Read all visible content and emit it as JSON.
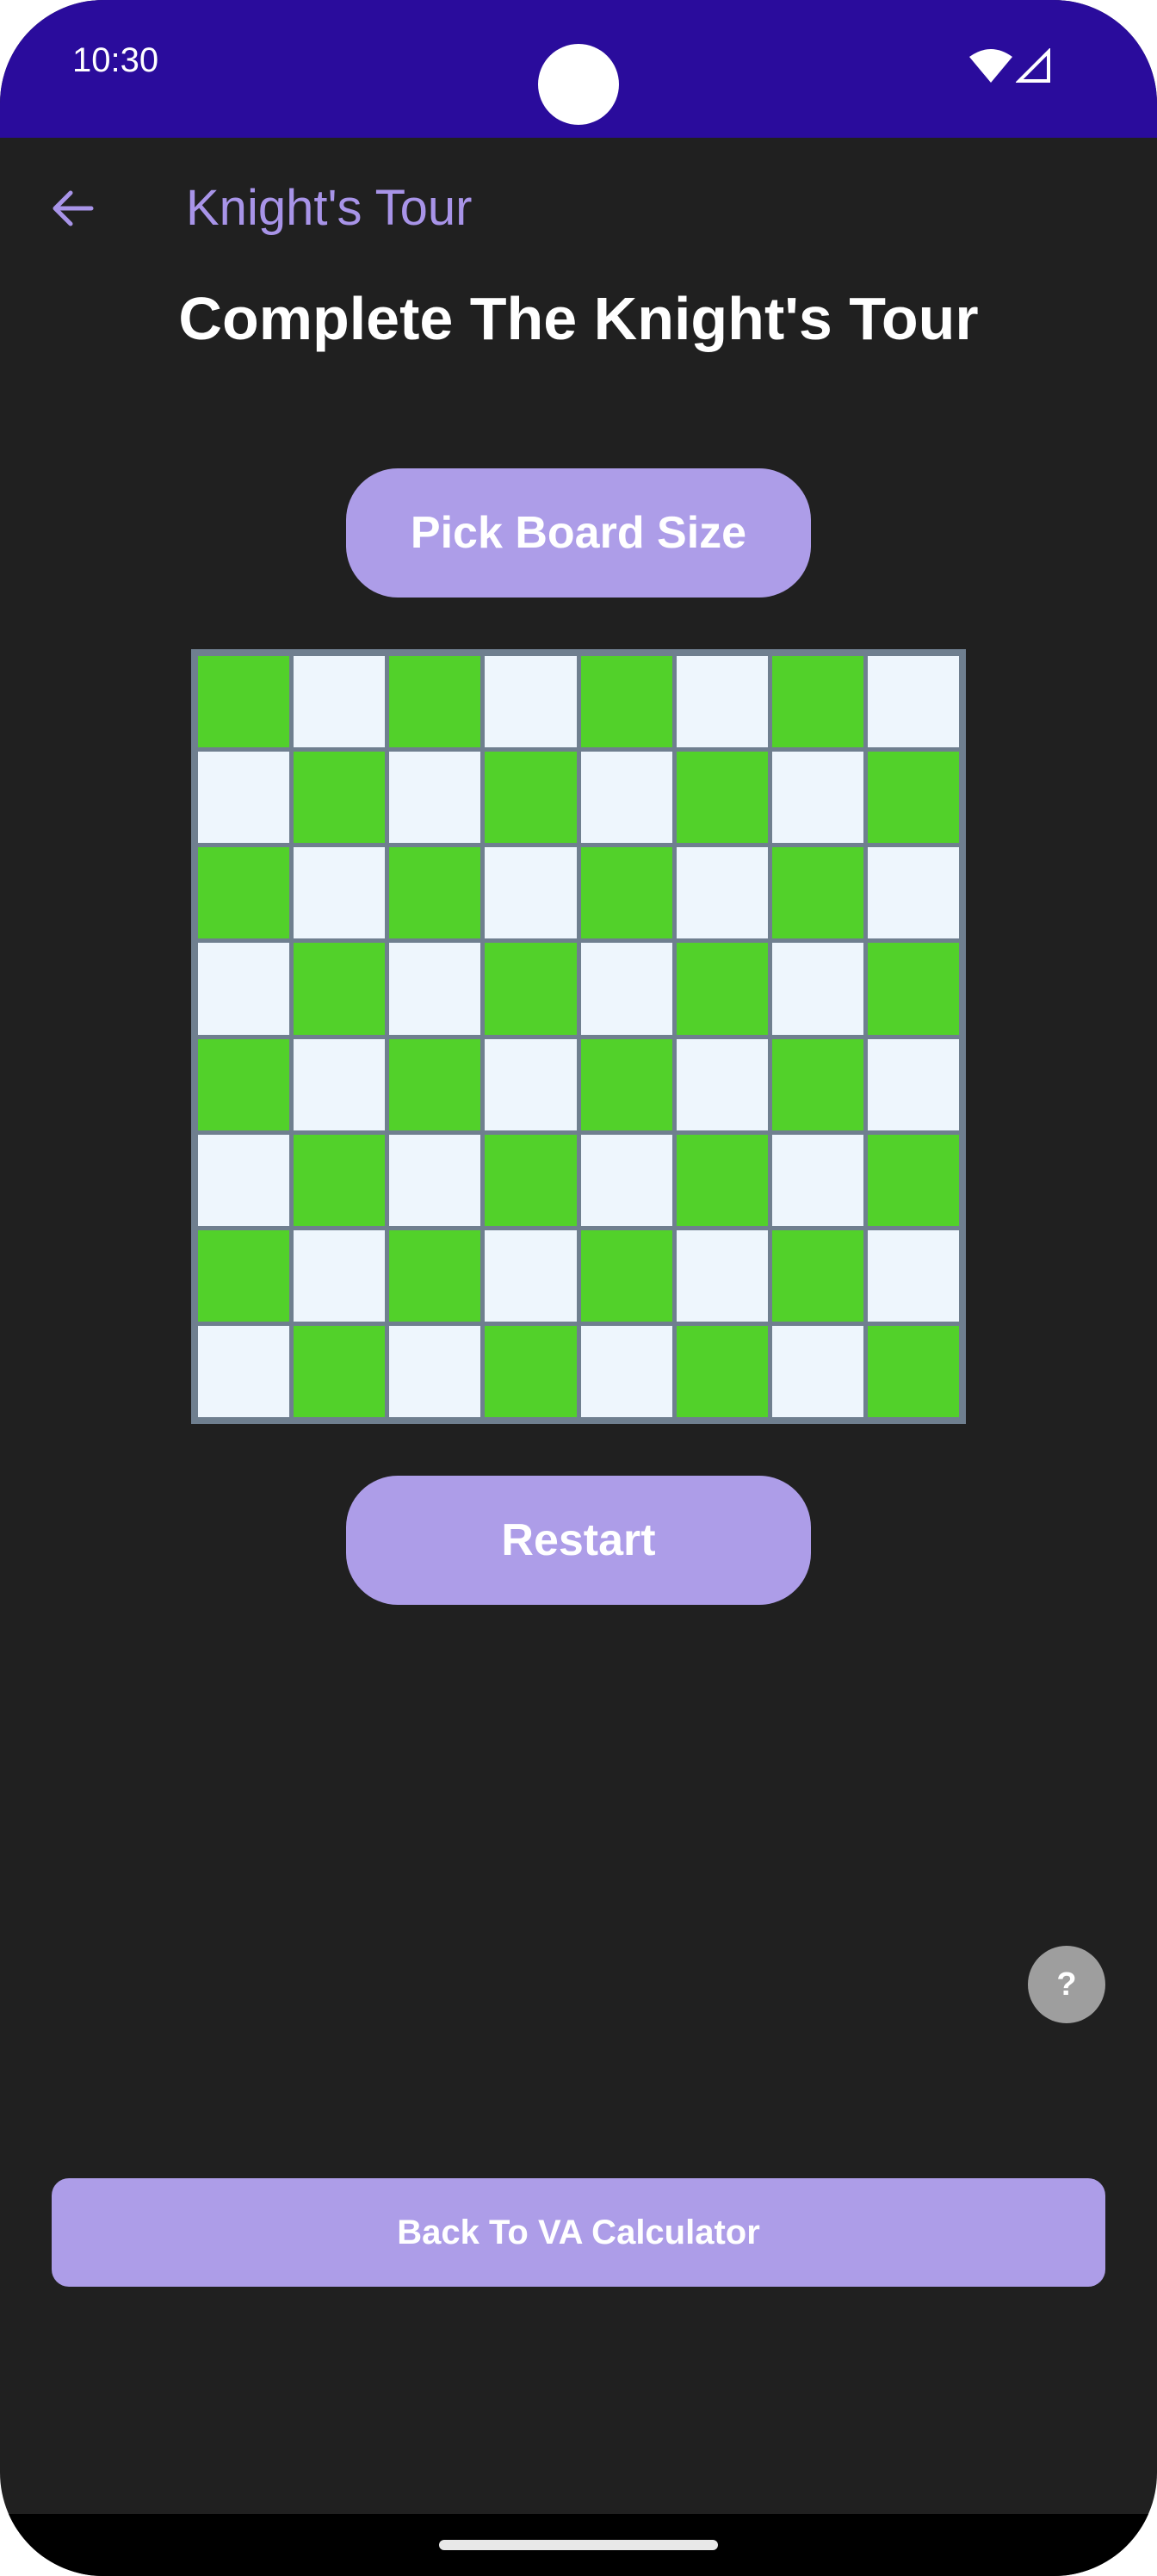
{
  "status_bar": {
    "time": "10:30",
    "icons": [
      "wifi-icon",
      "signal-icon"
    ]
  },
  "app_bar": {
    "back_icon": "arrow-left-icon",
    "title": "Knight's Tour"
  },
  "main": {
    "heading": "Complete The Knight's Tour",
    "pick_board_size_label": "Pick Board Size",
    "restart_label": "Restart",
    "help_label": "?",
    "back_to_calculator_label": "Back To VA Calculator"
  },
  "board": {
    "rows": 8,
    "cols": 8,
    "dark_color": "#52d12a",
    "light_color": "#eef6fd",
    "border_color": "#6f7f8f"
  },
  "colors": {
    "status_bar": "#2a0c9c",
    "background": "#202020",
    "accent": "#ad9de8",
    "title_accent": "#a894e8"
  }
}
